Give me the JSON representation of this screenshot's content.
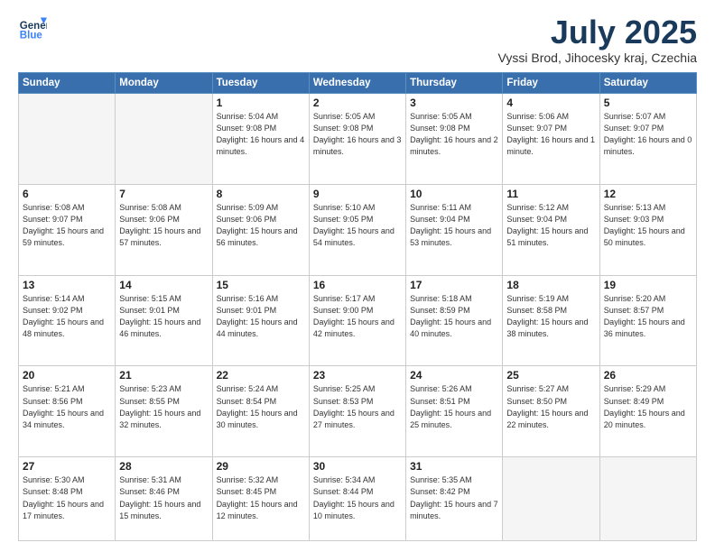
{
  "header": {
    "logo": {
      "line1": "General",
      "line2": "Blue"
    },
    "title": "July 2025",
    "subtitle": "Vyssi Brod, Jihocesky kraj, Czechia"
  },
  "days_of_week": [
    "Sunday",
    "Monday",
    "Tuesday",
    "Wednesday",
    "Thursday",
    "Friday",
    "Saturday"
  ],
  "weeks": [
    [
      {
        "day": "",
        "info": ""
      },
      {
        "day": "",
        "info": ""
      },
      {
        "day": "1",
        "info": "Sunrise: 5:04 AM\nSunset: 9:08 PM\nDaylight: 16 hours\nand 4 minutes."
      },
      {
        "day": "2",
        "info": "Sunrise: 5:05 AM\nSunset: 9:08 PM\nDaylight: 16 hours\nand 3 minutes."
      },
      {
        "day": "3",
        "info": "Sunrise: 5:05 AM\nSunset: 9:08 PM\nDaylight: 16 hours\nand 2 minutes."
      },
      {
        "day": "4",
        "info": "Sunrise: 5:06 AM\nSunset: 9:07 PM\nDaylight: 16 hours\nand 1 minute."
      },
      {
        "day": "5",
        "info": "Sunrise: 5:07 AM\nSunset: 9:07 PM\nDaylight: 16 hours\nand 0 minutes."
      }
    ],
    [
      {
        "day": "6",
        "info": "Sunrise: 5:08 AM\nSunset: 9:07 PM\nDaylight: 15 hours\nand 59 minutes."
      },
      {
        "day": "7",
        "info": "Sunrise: 5:08 AM\nSunset: 9:06 PM\nDaylight: 15 hours\nand 57 minutes."
      },
      {
        "day": "8",
        "info": "Sunrise: 5:09 AM\nSunset: 9:06 PM\nDaylight: 15 hours\nand 56 minutes."
      },
      {
        "day": "9",
        "info": "Sunrise: 5:10 AM\nSunset: 9:05 PM\nDaylight: 15 hours\nand 54 minutes."
      },
      {
        "day": "10",
        "info": "Sunrise: 5:11 AM\nSunset: 9:04 PM\nDaylight: 15 hours\nand 53 minutes."
      },
      {
        "day": "11",
        "info": "Sunrise: 5:12 AM\nSunset: 9:04 PM\nDaylight: 15 hours\nand 51 minutes."
      },
      {
        "day": "12",
        "info": "Sunrise: 5:13 AM\nSunset: 9:03 PM\nDaylight: 15 hours\nand 50 minutes."
      }
    ],
    [
      {
        "day": "13",
        "info": "Sunrise: 5:14 AM\nSunset: 9:02 PM\nDaylight: 15 hours\nand 48 minutes."
      },
      {
        "day": "14",
        "info": "Sunrise: 5:15 AM\nSunset: 9:01 PM\nDaylight: 15 hours\nand 46 minutes."
      },
      {
        "day": "15",
        "info": "Sunrise: 5:16 AM\nSunset: 9:01 PM\nDaylight: 15 hours\nand 44 minutes."
      },
      {
        "day": "16",
        "info": "Sunrise: 5:17 AM\nSunset: 9:00 PM\nDaylight: 15 hours\nand 42 minutes."
      },
      {
        "day": "17",
        "info": "Sunrise: 5:18 AM\nSunset: 8:59 PM\nDaylight: 15 hours\nand 40 minutes."
      },
      {
        "day": "18",
        "info": "Sunrise: 5:19 AM\nSunset: 8:58 PM\nDaylight: 15 hours\nand 38 minutes."
      },
      {
        "day": "19",
        "info": "Sunrise: 5:20 AM\nSunset: 8:57 PM\nDaylight: 15 hours\nand 36 minutes."
      }
    ],
    [
      {
        "day": "20",
        "info": "Sunrise: 5:21 AM\nSunset: 8:56 PM\nDaylight: 15 hours\nand 34 minutes."
      },
      {
        "day": "21",
        "info": "Sunrise: 5:23 AM\nSunset: 8:55 PM\nDaylight: 15 hours\nand 32 minutes."
      },
      {
        "day": "22",
        "info": "Sunrise: 5:24 AM\nSunset: 8:54 PM\nDaylight: 15 hours\nand 30 minutes."
      },
      {
        "day": "23",
        "info": "Sunrise: 5:25 AM\nSunset: 8:53 PM\nDaylight: 15 hours\nand 27 minutes."
      },
      {
        "day": "24",
        "info": "Sunrise: 5:26 AM\nSunset: 8:51 PM\nDaylight: 15 hours\nand 25 minutes."
      },
      {
        "day": "25",
        "info": "Sunrise: 5:27 AM\nSunset: 8:50 PM\nDaylight: 15 hours\nand 22 minutes."
      },
      {
        "day": "26",
        "info": "Sunrise: 5:29 AM\nSunset: 8:49 PM\nDaylight: 15 hours\nand 20 minutes."
      }
    ],
    [
      {
        "day": "27",
        "info": "Sunrise: 5:30 AM\nSunset: 8:48 PM\nDaylight: 15 hours\nand 17 minutes."
      },
      {
        "day": "28",
        "info": "Sunrise: 5:31 AM\nSunset: 8:46 PM\nDaylight: 15 hours\nand 15 minutes."
      },
      {
        "day": "29",
        "info": "Sunrise: 5:32 AM\nSunset: 8:45 PM\nDaylight: 15 hours\nand 12 minutes."
      },
      {
        "day": "30",
        "info": "Sunrise: 5:34 AM\nSunset: 8:44 PM\nDaylight: 15 hours\nand 10 minutes."
      },
      {
        "day": "31",
        "info": "Sunrise: 5:35 AM\nSunset: 8:42 PM\nDaylight: 15 hours\nand 7 minutes."
      },
      {
        "day": "",
        "info": ""
      },
      {
        "day": "",
        "info": ""
      }
    ]
  ]
}
